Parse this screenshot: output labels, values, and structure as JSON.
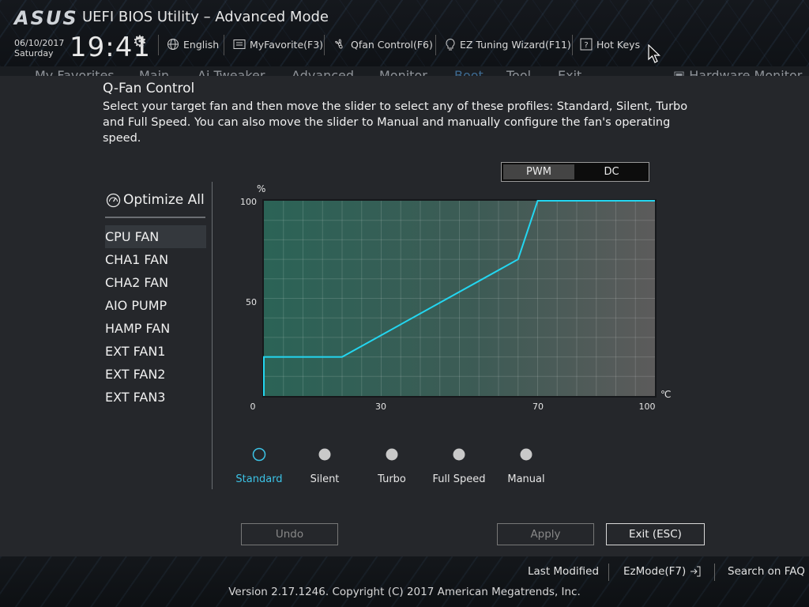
{
  "header": {
    "logo": "ASUS",
    "title": "UEFI BIOS Utility – Advanced Mode",
    "date": "06/10/2017",
    "weekday": "Saturday",
    "time": "19:41",
    "toolbar": {
      "language": "English",
      "favorite": "MyFavorite(F3)",
      "qfan": "Qfan Control(F6)",
      "ez_tuning": "EZ Tuning Wizard(F11)",
      "hotkeys": "Hot Keys"
    }
  },
  "menu": {
    "items": [
      "My Favorites",
      "Main",
      "Ai Tweaker",
      "Advanced",
      "Monitor",
      "Boot",
      "Tool",
      "Exit"
    ],
    "active": "Boot",
    "hardware_monitor": "Hardware Monitor"
  },
  "dialog": {
    "title": "Q-Fan Control",
    "description": "Select your target fan and then move the slider to select any of these profiles: Standard, Silent, Turbo and Full Speed. You can also move the slider to Manual and manually configure the fan's operating speed.",
    "mode_toggle": {
      "selected": "PWM",
      "other": "DC"
    },
    "optimize_all": "Optimize All",
    "fans": [
      "CPU FAN",
      "CHA1 FAN",
      "CHA2 FAN",
      "AIO PUMP",
      "HAMP FAN",
      "EXT FAN1",
      "EXT FAN2",
      "EXT FAN3"
    ],
    "selected_fan": "CPU FAN",
    "profiles": [
      "Standard",
      "Silent",
      "Turbo",
      "Full Speed",
      "Manual"
    ],
    "active_profile": "Standard",
    "buttons": {
      "undo": "Undo",
      "apply": "Apply",
      "exit": "Exit (ESC)"
    }
  },
  "chart_data": {
    "type": "line",
    "xlabel": "℃",
    "ylabel": "%",
    "xlim": [
      0,
      100
    ],
    "ylim": [
      0,
      100
    ],
    "x_ticks": [
      "0",
      "30",
      "70",
      "100"
    ],
    "y_ticks": [
      "100",
      "50"
    ],
    "grid": true,
    "series": [
      {
        "x": [
          0,
          0,
          20,
          65,
          70,
          100
        ],
        "y": [
          0,
          20,
          20,
          70,
          100,
          100
        ]
      }
    ],
    "line_color": "#23d6f0"
  },
  "footer": {
    "last_modified": "Last Modified",
    "ezmode": "EzMode(F7)",
    "search": "Search on FAQ",
    "copyright": "Version 2.17.1246. Copyright (C) 2017 American Megatrends, Inc."
  }
}
